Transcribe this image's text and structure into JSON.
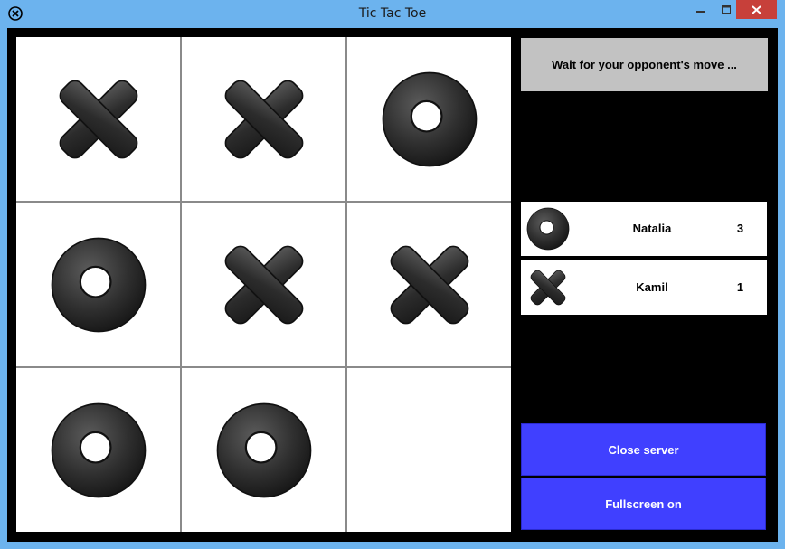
{
  "window": {
    "title": "Tic Tac Toe"
  },
  "board": {
    "cells": [
      "X",
      "X",
      "O",
      "O",
      "X",
      "X",
      "O",
      "O",
      ""
    ]
  },
  "status": {
    "message": "Wait for your opponent's move ..."
  },
  "players": [
    {
      "symbol": "O",
      "name": "Natalia",
      "score": "3"
    },
    {
      "symbol": "X",
      "name": "Kamil",
      "score": "1"
    }
  ],
  "buttons": {
    "close_server": "Close server",
    "fullscreen": "Fullscreen on"
  },
  "colors": {
    "titlebar": "#6cb3ee",
    "close_button": "#c7403a",
    "background": "#000000",
    "status_box": "#c2c2c2",
    "action_button": "#4040ff"
  }
}
